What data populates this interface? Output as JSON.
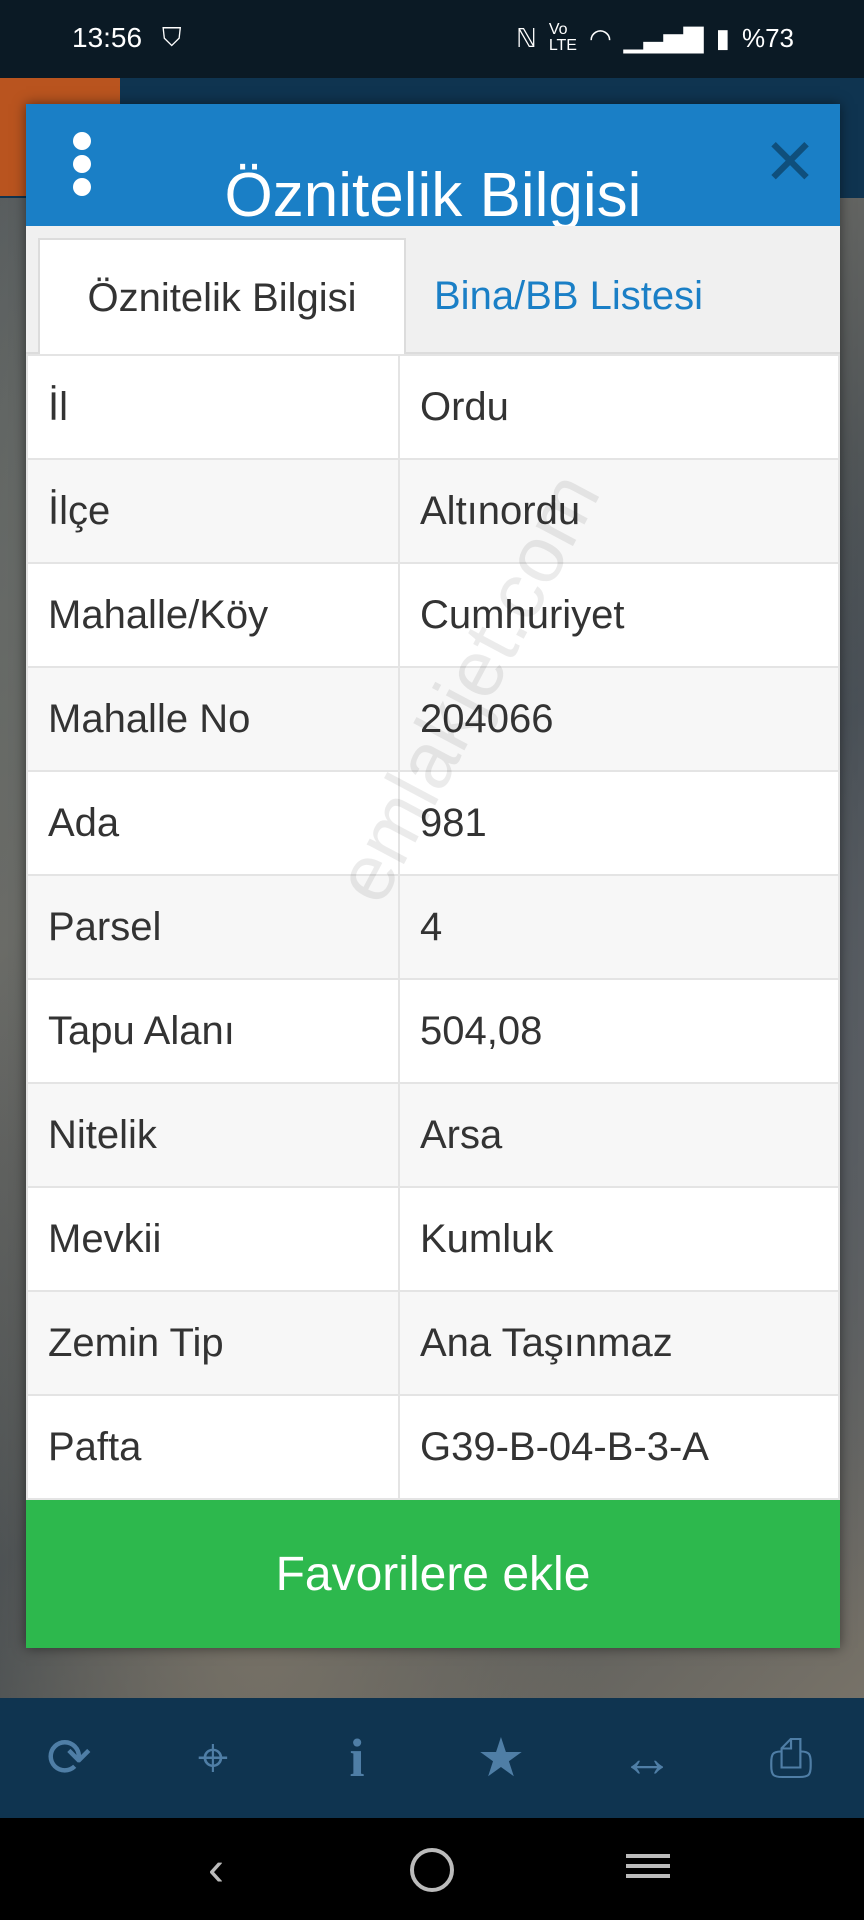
{
  "status_bar": {
    "time": "13:56",
    "battery": "%73",
    "icons": [
      "shield-icon",
      "nfc-icon",
      "volte-icon",
      "wifi-icon",
      "signal-icon",
      "battery-icon"
    ]
  },
  "dialog": {
    "title": "Öznitelik Bilgisi",
    "tabs": [
      {
        "label": "Öznitelik Bilgisi",
        "active": true
      },
      {
        "label": "Bina/BB Listesi",
        "active": false
      }
    ],
    "rows": [
      {
        "key": "İl",
        "value": "Ordu"
      },
      {
        "key": "İlçe",
        "value": "Altınordu"
      },
      {
        "key": "Mahalle/Köy",
        "value": "Cumhuriyet"
      },
      {
        "key": "Mahalle No",
        "value": "204066"
      },
      {
        "key": "Ada",
        "value": "981"
      },
      {
        "key": "Parsel",
        "value": "4"
      },
      {
        "key": "Tapu Alanı",
        "value": "504,08"
      },
      {
        "key": "Nitelik",
        "value": "Arsa"
      },
      {
        "key": "Mevkii",
        "value": "Kumluk"
      },
      {
        "key": "Zemin Tip",
        "value": "Ana Taşınmaz"
      },
      {
        "key": "Pafta",
        "value": "G39-B-04-B-3-A"
      }
    ],
    "favorite_button": "Favorilere ekle",
    "watermark": "emlakjet.com"
  },
  "toolbar": {
    "icons": [
      "refresh-icon",
      "crosshair-icon",
      "info-icon",
      "star-icon",
      "measure-icon",
      "print-icon"
    ]
  },
  "colors": {
    "header_blue": "#1a7fc6",
    "button_green": "#2db84d",
    "toolbar_navy": "#0f3450"
  }
}
